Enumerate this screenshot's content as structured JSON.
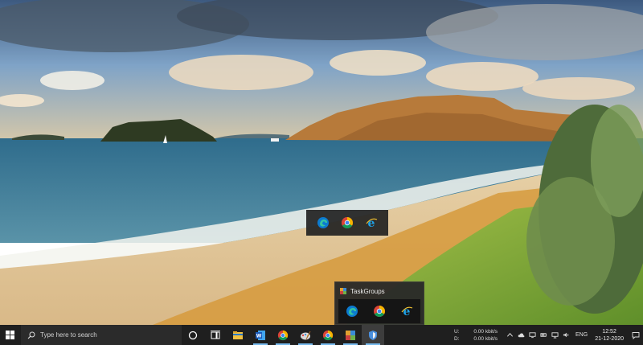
{
  "popup_group": {
    "apps": [
      "edge",
      "chrome",
      "internet-explorer"
    ]
  },
  "taskgroups_flyout": {
    "title": "TaskGroups",
    "apps": [
      "edge",
      "chrome",
      "internet-explorer"
    ]
  },
  "taskbar": {
    "search_placeholder": "Type here to search",
    "pinned": [
      {
        "icon": "file-explorer-icon"
      },
      {
        "icon": "word-icon"
      },
      {
        "icon": "chrome-icon"
      },
      {
        "icon": "paint-icon"
      },
      {
        "icon": "chrome-icon"
      },
      {
        "icon": "taskgroups-app-icon"
      },
      {
        "icon": "taskgroups-shield-icon"
      }
    ],
    "netspeed": {
      "upload_label": "U:",
      "upload_value": "0.00 kbit/s",
      "download_label": "D:",
      "download_value": "0.00 kbit/s"
    },
    "language": "ENG",
    "time": "12:52",
    "date": "21-12-2020"
  },
  "colors": {
    "taskbar_bg": "#1f1f1f",
    "accent": "#76b9ed"
  }
}
